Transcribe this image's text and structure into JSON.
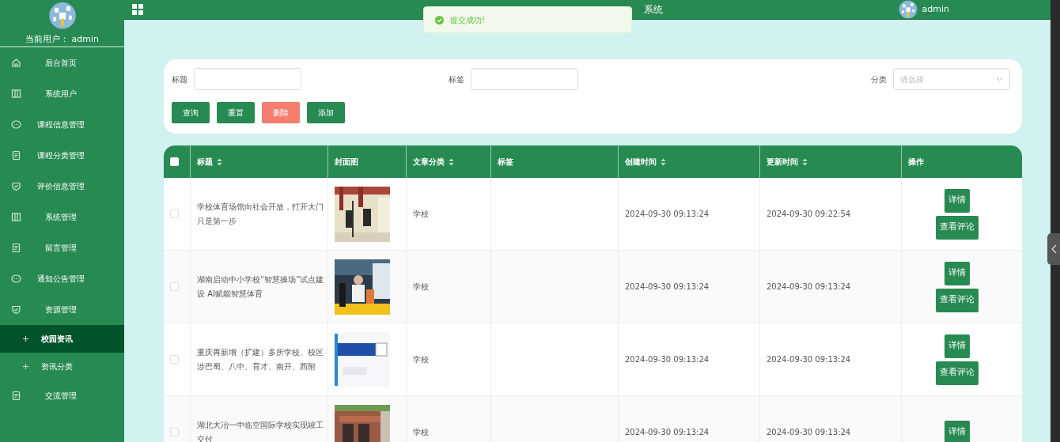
{
  "sidebar": {
    "current_user": "当前用户： admin",
    "items": [
      {
        "label": "后台首页",
        "kind": "menu",
        "selected": false
      },
      {
        "label": "系统用户",
        "kind": "menu",
        "selected": false
      },
      {
        "label": "课程信息管理",
        "kind": "menu",
        "selected": false
      },
      {
        "label": "课程分类管理",
        "kind": "menu",
        "selected": false
      },
      {
        "label": "评价信息管理",
        "kind": "menu",
        "selected": false
      },
      {
        "label": "系统管理",
        "kind": "menu",
        "selected": false
      },
      {
        "label": "留言管理",
        "kind": "menu",
        "selected": false
      },
      {
        "label": "通知公告管理",
        "kind": "menu",
        "selected": false
      },
      {
        "label": "资源管理",
        "kind": "menu",
        "selected": false
      },
      {
        "label": "校园资讯",
        "kind": "submenu",
        "selected": true
      },
      {
        "label": "资讯分类",
        "kind": "submenu",
        "selected": false
      },
      {
        "label": "交流管理",
        "kind": "menu",
        "selected": false
      }
    ]
  },
  "header": {
    "title": "系统",
    "user": "admin"
  },
  "toast": {
    "message": "提交成功!"
  },
  "search": {
    "fields": [
      {
        "label": "标题",
        "kind": "text"
      },
      {
        "label": "标签",
        "kind": "text"
      },
      {
        "label": "分类",
        "kind": "select",
        "placeholder": "请选择"
      }
    ],
    "buttons": [
      {
        "label": "查询",
        "kind": "primary"
      },
      {
        "label": "重置",
        "kind": "primary"
      },
      {
        "label": "删除",
        "kind": "danger"
      },
      {
        "label": "添加",
        "kind": "primary"
      }
    ]
  },
  "table": {
    "select_all": {
      "checked": false
    },
    "columns": [
      {
        "label": "标题",
        "sortable": true
      },
      {
        "label": "封面图",
        "sortable": false
      },
      {
        "label": "文章分类",
        "sortable": true
      },
      {
        "label": "标签",
        "sortable": false
      },
      {
        "label": "创建时间",
        "sortable": true
      },
      {
        "label": "更新时间",
        "sortable": true
      },
      {
        "label": "操作",
        "sortable": false
      }
    ],
    "rows": [
      {
        "checked": false,
        "title": "学校体育场馆向社会开放，打开大门只是第一步",
        "cover": {
          "kind": "picture"
        },
        "category": "学校",
        "created": "2024-09-30 09:13:24",
        "updated": "2024-09-30 09:22:54",
        "actions": [
          "详情",
          "查看评论"
        ]
      },
      {
        "checked": false,
        "title": "湖南启动中小学校“智慧操场”试点建设 AI赋能智慧体育",
        "cover": {
          "kind": "picture"
        },
        "category": "学校",
        "created": "2024-09-30 09:13:24",
        "updated": "2024-09-30 09:13:24",
        "actions": [
          "详情",
          "查看评论"
        ]
      },
      {
        "checked": false,
        "title": "重庆再新增（扩建）多所学校、校区涉巴蜀、八中、育才、南开、西附",
        "cover": {
          "kind": "picture"
        },
        "category": "学校",
        "created": "2024-09-30 09:13:24",
        "updated": "2024-09-30 09:13:24",
        "actions": [
          "详情",
          "查看评论"
        ]
      },
      {
        "checked": false,
        "title": "湖北大冶一中临空国际学校实现竣工交付",
        "cover": {
          "kind": "picture"
        },
        "category": "学校",
        "created": "2024-09-30 09:13:24",
        "updated": "2024-09-30 09:13:24",
        "actions": [
          "详情"
        ]
      }
    ]
  }
}
